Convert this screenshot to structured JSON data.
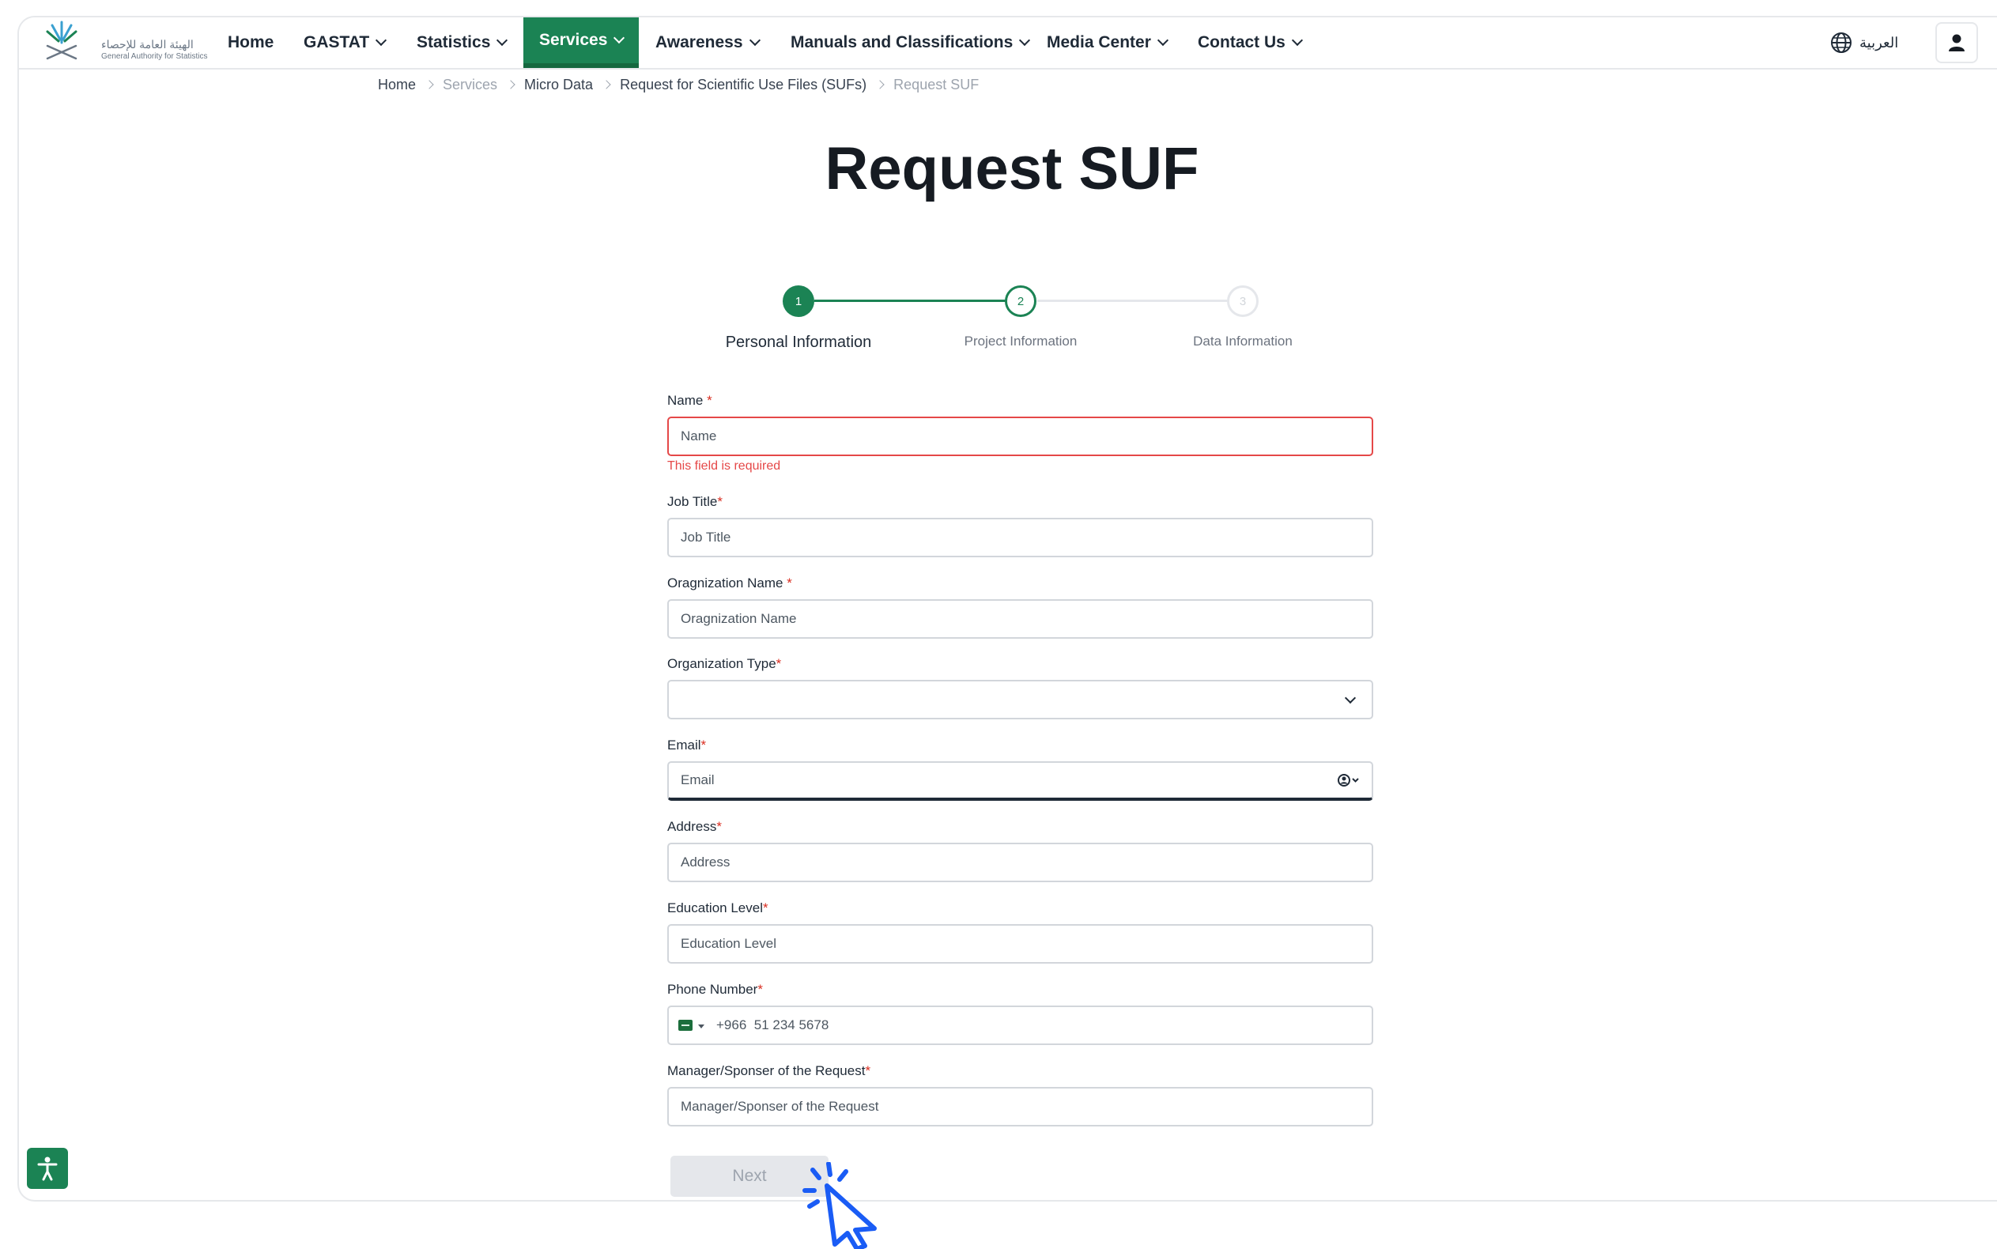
{
  "brand": {
    "name_ar": "الهيئة العامة للإحصاء",
    "name_en": "General Authority for Statistics",
    "accent": "#1b8354",
    "error_color": "#e54848"
  },
  "nav": {
    "items": [
      {
        "label": "Home",
        "has_dropdown": false
      },
      {
        "label": "GASTAT",
        "has_dropdown": true
      },
      {
        "label": "Statistics",
        "has_dropdown": true
      },
      {
        "label": "Services",
        "has_dropdown": true,
        "active": true
      },
      {
        "label": "Awareness",
        "has_dropdown": true
      },
      {
        "label": "Manuals and Classifications",
        "has_dropdown": true
      },
      {
        "label": "Media Center",
        "has_dropdown": true
      },
      {
        "label": "Contact Us",
        "has_dropdown": true
      }
    ],
    "language_label": "العربية",
    "language_icon": "globe-icon",
    "user_icon": "user-icon"
  },
  "breadcrumb": [
    {
      "label": "Home"
    },
    {
      "label": "Services",
      "muted": true
    },
    {
      "label": "Micro Data"
    },
    {
      "label": "Request for Scientific Use Files (SUFs)"
    },
    {
      "label": "Request SUF",
      "muted": true
    }
  ],
  "page": {
    "title": "Request SUF"
  },
  "stepper": {
    "current": 1,
    "steps": [
      {
        "number": "1",
        "label": "Personal Information",
        "state": "active"
      },
      {
        "number": "2",
        "label": "Project Information",
        "state": "next"
      },
      {
        "number": "3",
        "label": "Data Information",
        "state": "pending"
      }
    ]
  },
  "form": {
    "name": {
      "label": "Name",
      "required_mark": "*",
      "placeholder": "Name",
      "value": "",
      "error": "This field is required"
    },
    "job_title": {
      "label": "Job Title",
      "required_mark": "*",
      "placeholder": "Job Title",
      "value": ""
    },
    "organization_name": {
      "label": "Oragnization Name",
      "required_mark": "*",
      "placeholder": "Oragnization Name",
      "value": ""
    },
    "organization_type": {
      "label": "Organization Type",
      "required_mark": "*",
      "value": ""
    },
    "email": {
      "label": "Email",
      "required_mark": "*",
      "placeholder": "Email",
      "value": ""
    },
    "address": {
      "label": "Address",
      "required_mark": "*",
      "placeholder": "Address",
      "value": ""
    },
    "education_level": {
      "label": "Education Level",
      "required_mark": "*",
      "placeholder": "Education Level",
      "value": ""
    },
    "phone_number": {
      "label": "Phone Number",
      "required_mark": "*",
      "placeholder": "+966  51 234 5678",
      "value": "",
      "country": "SA"
    },
    "manager": {
      "label": "Manager/Sponser of the Request",
      "required_mark": "*",
      "placeholder": "Manager/Sponser of the Request",
      "value": ""
    }
  },
  "actions": {
    "next_label": "Next",
    "next_disabled": true
  },
  "accessibility_icon": "accessibility-icon"
}
